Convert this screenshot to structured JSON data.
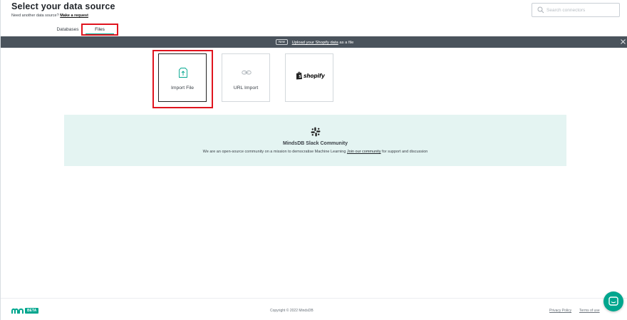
{
  "header": {
    "title": "Select your data source",
    "subtitle_prefix": "Need another data source?",
    "request_link": "Make a request",
    "search_placeholder": "Search connectors"
  },
  "tabs": [
    {
      "label": "Databases",
      "active": false
    },
    {
      "label": "Files",
      "active": true
    }
  ],
  "banner": {
    "badge": "New",
    "link": "Upload your Shopify data",
    "suffix": "as a file",
    "close_icon": "close-icon"
  },
  "sources": [
    {
      "label": "Import File",
      "icon": "file-import-icon",
      "selected": true
    },
    {
      "label": "URL Import",
      "icon": "link-icon",
      "selected": false
    },
    {
      "label": "shopify",
      "icon": "shopify-logo",
      "selected": false
    }
  ],
  "community": {
    "icon": "slack-icon",
    "title": "MindsDB Slack Community",
    "desc_prefix": "We are an open-source community on a mission to democratise Machine Learning",
    "link": "Join our community",
    "desc_suffix": "for support and discussion"
  },
  "footer": {
    "beta": "BETA",
    "copyright": "Copyright © 2022 MindsDB",
    "privacy": "Privacy Policy",
    "terms": "Terms of use"
  },
  "colors": {
    "accent": "#00a68e",
    "banner_bg": "#4a535c",
    "community_bg": "#e4f4f2",
    "highlight": "#e0141e"
  }
}
